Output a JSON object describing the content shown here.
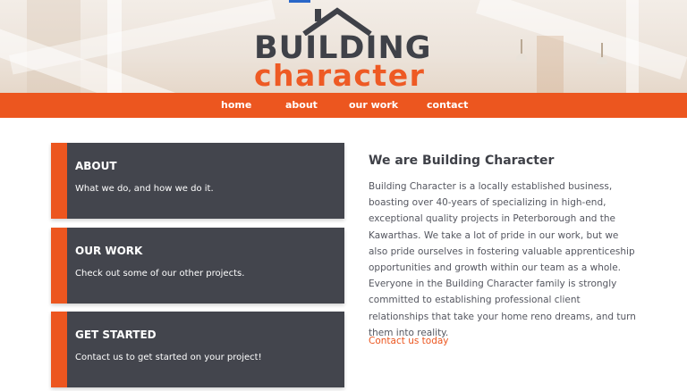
{
  "brand": {
    "logo_line1": "BUILDING",
    "logo_line2": "character",
    "primary_color": "#ec561f",
    "dark_color": "#43454d"
  },
  "nav": {
    "items": [
      {
        "label": "home"
      },
      {
        "label": "about"
      },
      {
        "label": "our work"
      },
      {
        "label": "contact"
      }
    ]
  },
  "cards": [
    {
      "title": "ABOUT",
      "description": "What we do, and how we do it."
    },
    {
      "title": "OUR WORK",
      "description": "Check out some of our other projects."
    },
    {
      "title": "GET STARTED",
      "description": "Contact us to get started on your project!"
    }
  ],
  "intro": {
    "title": "We are Building Character",
    "body": "Building Character is a locally established business, boasting over 40-years of specializing in high-end, exceptional quality projects in Peterborough and the Kawarthas. We take a lot of pride in our work, but we also pride ourselves in fostering valuable apprenticeship opportunities and growth within our team as a whole. Everyone in the Building Character family is strongly committed to establishing professional client relationships that take your home reno dreams, and turn them into reality.",
    "link_label": "Contact us today"
  }
}
